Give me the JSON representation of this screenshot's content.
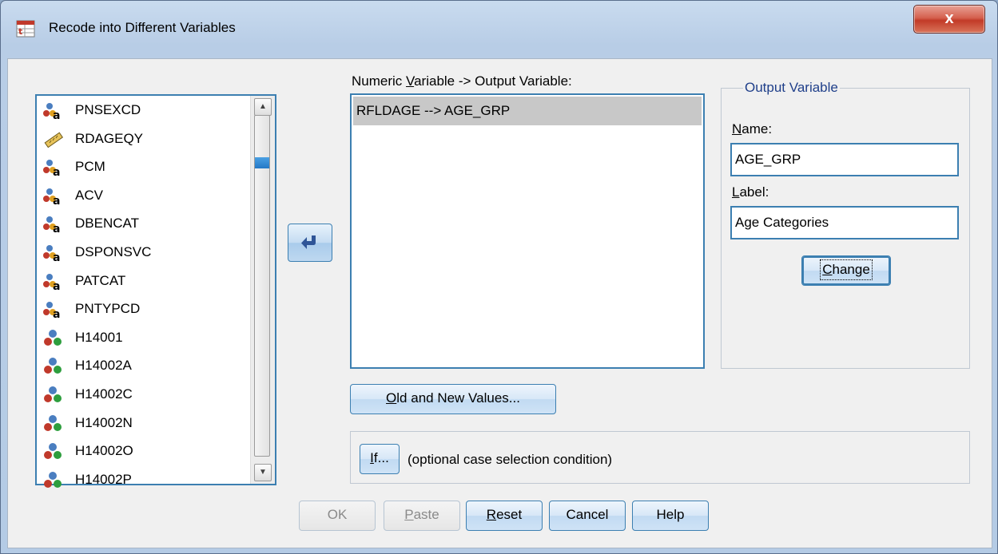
{
  "window": {
    "title": "Recode into Different Variables",
    "close_label": "x"
  },
  "variable_list": {
    "items": [
      {
        "name": "PNSEXCD",
        "icon": "nominal-string-icon"
      },
      {
        "name": "RDAGEQY",
        "icon": "scale-ruler-icon"
      },
      {
        "name": "PCM",
        "icon": "nominal-string-icon"
      },
      {
        "name": "ACV",
        "icon": "nominal-string-icon"
      },
      {
        "name": "DBENCAT",
        "icon": "nominal-string-icon"
      },
      {
        "name": "DSPONSVC",
        "icon": "nominal-string-icon"
      },
      {
        "name": "PATCAT",
        "icon": "nominal-string-icon"
      },
      {
        "name": "PNTYPCD",
        "icon": "nominal-string-icon"
      },
      {
        "name": "H14001",
        "icon": "nominal-icon"
      },
      {
        "name": "H14002A",
        "icon": "nominal-icon"
      },
      {
        "name": "H14002C",
        "icon": "nominal-icon"
      },
      {
        "name": "H14002N",
        "icon": "nominal-icon"
      },
      {
        "name": "H14002O",
        "icon": "nominal-icon"
      },
      {
        "name": "H14002P",
        "icon": "nominal-icon"
      }
    ]
  },
  "recode": {
    "label_prefix": "Numeric ",
    "label_mnemonic": "V",
    "label_suffix": "ariable -> Output Variable:",
    "rows": [
      "RFLDAGE --> AGE_GRP"
    ]
  },
  "output_variable": {
    "legend": "Output Variable",
    "name_mnemonic": "N",
    "name_rest": "ame:",
    "name_value": "AGE_GRP",
    "label_mnemonic": "L",
    "label_rest": "abel:",
    "label_value": "Age Categories",
    "change_mnemonic": "C",
    "change_rest": "hange"
  },
  "old_new_button": {
    "mnemonic": "O",
    "rest": "ld and New Values..."
  },
  "if_section": {
    "button_mnemonic": "I",
    "button_rest": "f...",
    "description": "(optional case selection condition)"
  },
  "footer": {
    "ok": "OK",
    "paste_mnemonic": "P",
    "paste_rest": "aste",
    "reset_mnemonic": "R",
    "reset_rest": "eset",
    "cancel": "Cancel",
    "help": "Help"
  }
}
